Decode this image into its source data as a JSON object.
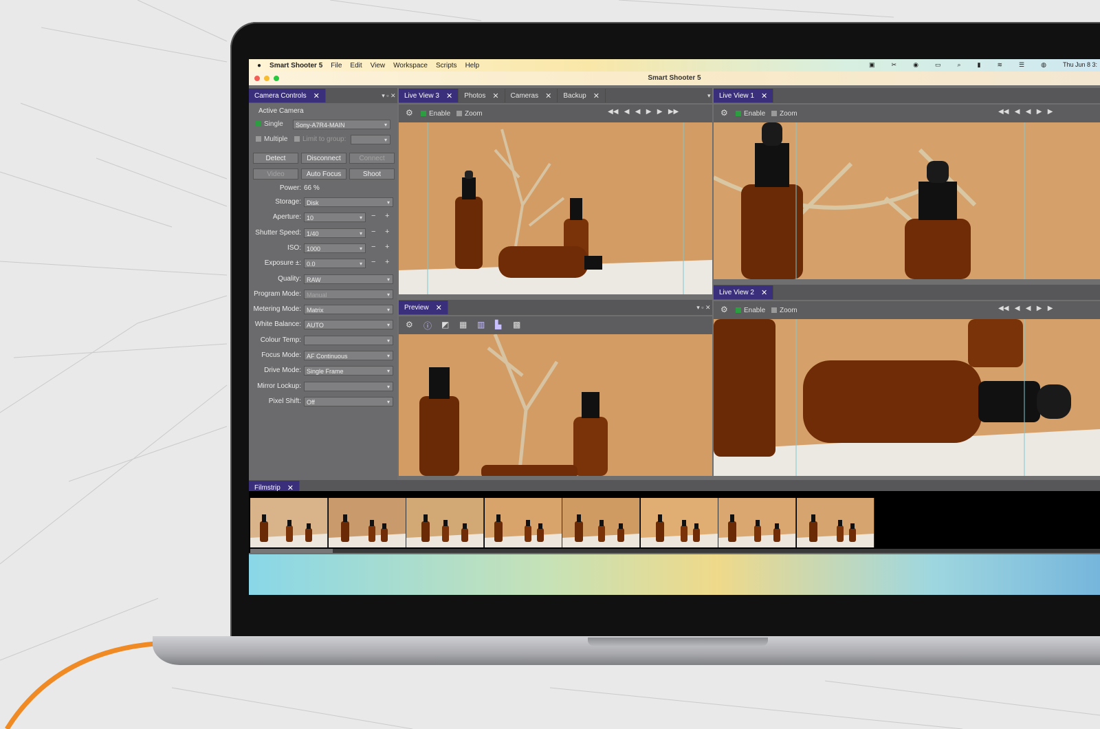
{
  "menubar": {
    "app_name": "Smart Shooter 5",
    "items": [
      "File",
      "Edit",
      "View",
      "Workspace",
      "Scripts",
      "Help"
    ],
    "clock": "Thu Jun 8 3:"
  },
  "window": {
    "title": "Smart Shooter 5"
  },
  "camera_controls": {
    "tab_label": "Camera Controls",
    "active_camera_label": "Active Camera",
    "single_label": "Single",
    "single_value": "Sony-A7R4-MAIN",
    "multiple_label": "Multiple",
    "limit_group_label": "Limit to group:",
    "buttons": {
      "detect": "Detect",
      "disconnect": "Disconnect",
      "connect": "Connect",
      "video": "Video",
      "auto_focus": "Auto Focus",
      "shoot": "Shoot"
    },
    "power_label": "Power:",
    "power_value": "66 %",
    "fields": [
      {
        "label": "Storage:",
        "value": "Disk"
      },
      {
        "label": "Aperture:",
        "value": "10"
      },
      {
        "label": "Shutter Speed:",
        "value": "1/40"
      },
      {
        "label": "ISO:",
        "value": "1000"
      },
      {
        "label": "Exposure ±:",
        "value": "0.0"
      },
      {
        "label": "Quality:",
        "value": "RAW"
      },
      {
        "label": "Program Mode:",
        "value": "Manual"
      },
      {
        "label": "Metering Mode:",
        "value": "Matrix"
      },
      {
        "label": "White Balance:",
        "value": "AUTO"
      },
      {
        "label": "Colour Temp:",
        "value": ""
      },
      {
        "label": "Focus Mode:",
        "value": "AF Continuous"
      },
      {
        "label": "Drive Mode:",
        "value": "Single Frame"
      },
      {
        "label": "Mirror Lockup:",
        "value": ""
      },
      {
        "label": "Pixel Shift:",
        "value": "Off"
      }
    ]
  },
  "center_tabs": [
    "Live View 3",
    "Photos",
    "Cameras",
    "Backup"
  ],
  "live_view_1_tab": "Live View 1",
  "live_view_2_tab": "Live View 2",
  "preview_tab": "Preview",
  "toolbar": {
    "enable_label": "Enable",
    "zoom_label": "Zoom"
  },
  "filmstrip": {
    "tab_label": "Filmstrip",
    "thumbnail_count": 8
  },
  "colors": {
    "accent": "#3a2f7a",
    "enabled_check": "#2c9d40",
    "cable": "#f08a24"
  }
}
